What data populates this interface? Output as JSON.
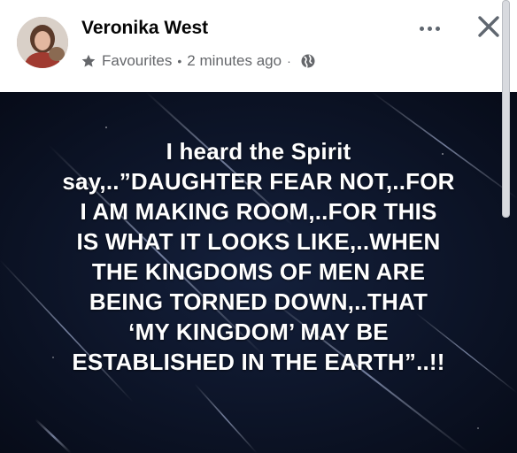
{
  "post": {
    "author": "Veronika West",
    "audience_label": "Favourites",
    "separator": "•",
    "timestamp": "2 minutes ago",
    "timestamp_separator": "·",
    "icons": {
      "audience": "star-icon",
      "privacy": "globe-icon",
      "more": "more-options-icon",
      "close": "close-icon"
    },
    "image_text_lines": [
      "I heard the Spirit",
      "say,..”DAUGHTER FEAR NOT,..FOR",
      "I AM MAKING ROOM,..FOR THIS",
      "IS WHAT IT LOOKS LIKE,..WHEN",
      "THE KINGDOMS OF MEN ARE",
      "BEING TORNED DOWN,..THAT",
      "‘MY KINGDOM’ MAY BE",
      "ESTABLISHED IN THE EARTH”..!!"
    ]
  },
  "colors": {
    "accent": "#1877f2",
    "author_text": "#050505",
    "meta_text": "#65676b",
    "image_background": "#0b1224",
    "image_text": "#ffffff"
  }
}
